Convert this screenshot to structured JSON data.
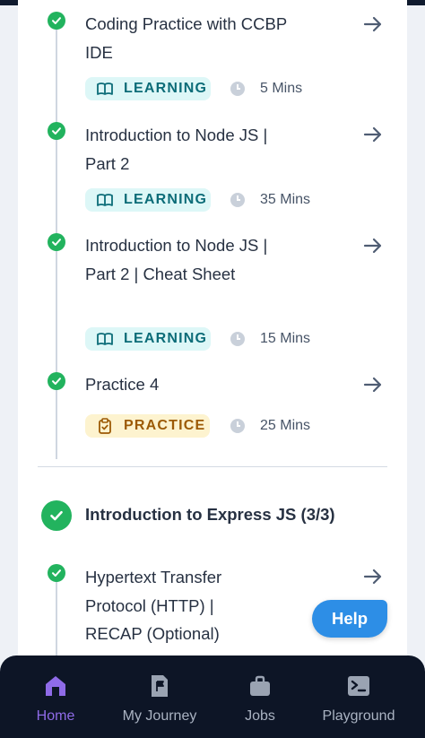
{
  "items": [
    {
      "title": "Coding Practice with CCBP IDE",
      "tag": "LEARNING",
      "duration": "5 Mins"
    },
    {
      "title": "Introduction to Node JS | Part 2",
      "tag": "LEARNING",
      "duration": "35 Mins"
    },
    {
      "title": "Introduction to Node JS | Part 2 | Cheat Sheet",
      "tag": "LEARNING",
      "duration": "15 Mins"
    },
    {
      "title": "Practice 4",
      "tag": "PRACTICE",
      "duration": "25 Mins"
    }
  ],
  "section": {
    "title": "Introduction to Express JS (3/3)"
  },
  "next_item": {
    "title": "Hypertext Transfer Protocol (HTTP) | RECAP (Optional)"
  },
  "help_button": "Help",
  "bottom_nav": [
    {
      "label": "Home",
      "icon": "home-icon",
      "active": true
    },
    {
      "label": "My Journey",
      "icon": "flag-document-icon",
      "active": false
    },
    {
      "label": "Jobs",
      "icon": "briefcase-icon",
      "active": false
    },
    {
      "label": "Playground",
      "icon": "terminal-icon",
      "active": false
    }
  ],
  "colors": {
    "check_green": "#22b35e",
    "learning_bg": "#ddf7f7",
    "learning_text": "#0c6c78",
    "practice_bg": "#fdf3cf",
    "practice_text": "#9c5a05",
    "help_blue": "#2d8ee6",
    "nav_bg": "#0d1526",
    "nav_active": "#8f6be8"
  }
}
